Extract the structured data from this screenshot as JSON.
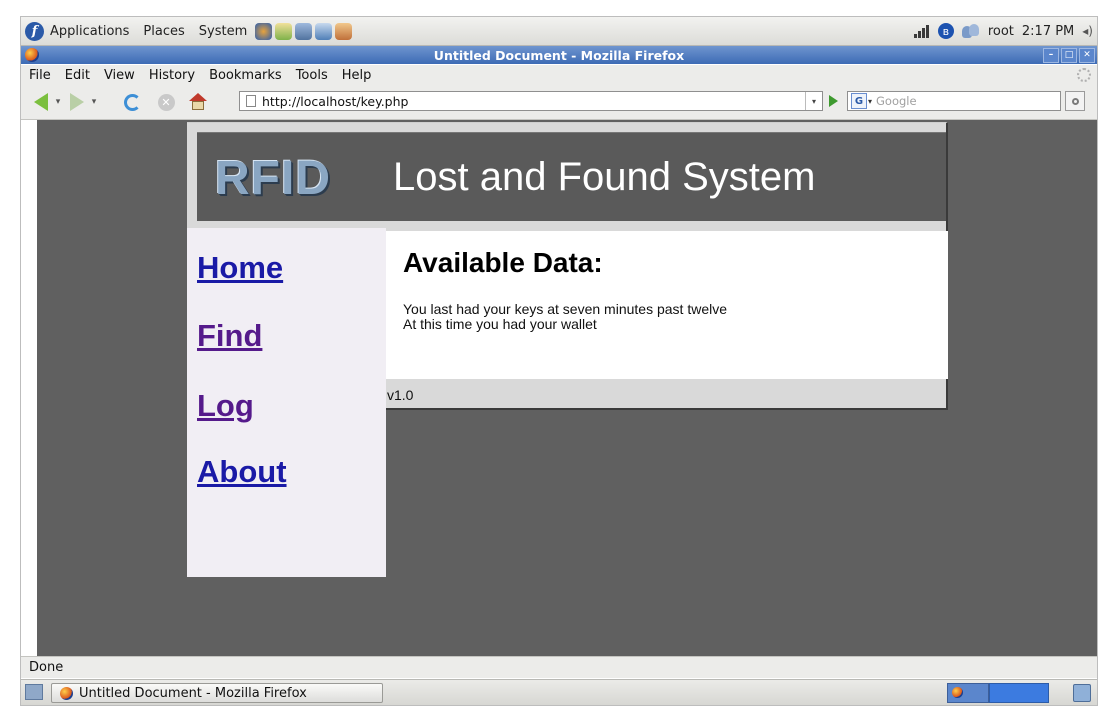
{
  "top_panel": {
    "menus": [
      "Applications",
      "Places",
      "System"
    ],
    "user": "root",
    "clock": "2:17 PM"
  },
  "browser": {
    "window_title": "Untitled Document - Mozilla Firefox",
    "menu": [
      "File",
      "Edit",
      "View",
      "History",
      "Bookmarks",
      "Tools",
      "Help"
    ],
    "url": "http://localhost/key.php",
    "search_placeholder": "Google",
    "status": "Done"
  },
  "site": {
    "logo": "RFID",
    "banner_title": "Lost and Found System",
    "nav": [
      "Home",
      "Find",
      "Log",
      "About"
    ],
    "heading": "Available Data:",
    "lines": [
      "You last had your keys at seven minutes past twelve",
      "At this time you had your wallet"
    ],
    "version": "v1.0"
  },
  "taskbar": {
    "window_button": "Untitled Document - Mozilla Firefox"
  },
  "colors": {
    "page_background": "#606060",
    "banner_background": "#5a5a5a",
    "sidebar_background": "#f1eef4",
    "link": "#1a1aa6",
    "visited_link": "#551a8b",
    "titlebar": "#4a76bd"
  }
}
